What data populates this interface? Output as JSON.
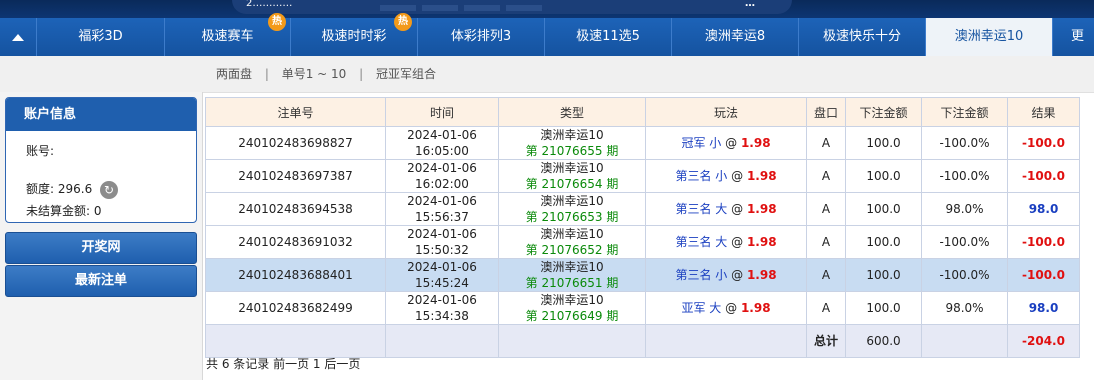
{
  "top": {
    "left_text": "2…………",
    "right_text": "…"
  },
  "nav": {
    "tabs": [
      {
        "label": "福彩3D",
        "hot": false
      },
      {
        "label": "极速赛车",
        "hot": true
      },
      {
        "label": "极速时时彩",
        "hot": true
      },
      {
        "label": "体彩排列3",
        "hot": false
      },
      {
        "label": "极速11选5",
        "hot": false
      },
      {
        "label": "澳洲幸运8",
        "hot": false
      },
      {
        "label": "极速快乐十分",
        "hot": false
      },
      {
        "label": "澳洲幸运10",
        "hot": false,
        "active": true
      },
      {
        "label": "更多",
        "hot": false
      }
    ],
    "hot_label": "热"
  },
  "subnav": {
    "links": [
      "两面盘",
      "单号1 ~ 10",
      "冠亚军组合"
    ],
    "separator": "|"
  },
  "sidebar": {
    "title": "账户信息",
    "account_label": "账号:",
    "account_value": "",
    "credit_label": "额度:",
    "credit_value": "296.6",
    "unsettled_label": "未结算金额:",
    "unsettled_value": "0",
    "draw_button": "开奖网",
    "latest_button": "最新注单"
  },
  "table": {
    "headers": [
      "注单号",
      "时间",
      "类型",
      "玩法",
      "盘口",
      "下注金额",
      "下注金额",
      "结果"
    ],
    "rows": [
      {
        "id": "240102483698827",
        "date": "2024-01-06",
        "time": "16:05:00",
        "game": "澳洲幸运10",
        "issue": "第 21076655 期",
        "pos": "冠军",
        "pick": "小",
        "at": "@",
        "odds": "1.98",
        "pan": "A",
        "amount": "100.0",
        "pct": "-100.0%",
        "result": "-100.0",
        "result_type": "loss"
      },
      {
        "id": "240102483697387",
        "date": "2024-01-06",
        "time": "16:02:00",
        "game": "澳洲幸运10",
        "issue": "第 21076654 期",
        "pos": "第三名",
        "pick": "小",
        "at": "@",
        "odds": "1.98",
        "pan": "A",
        "amount": "100.0",
        "pct": "-100.0%",
        "result": "-100.0",
        "result_type": "loss"
      },
      {
        "id": "240102483694538",
        "date": "2024-01-06",
        "time": "15:56:37",
        "game": "澳洲幸运10",
        "issue": "第 21076653 期",
        "pos": "第三名",
        "pick": "大",
        "at": "@",
        "odds": "1.98",
        "pan": "A",
        "amount": "100.0",
        "pct": "98.0%",
        "result": "98.0",
        "result_type": "win"
      },
      {
        "id": "240102483691032",
        "date": "2024-01-06",
        "time": "15:50:32",
        "game": "澳洲幸运10",
        "issue": "第 21076652 期",
        "pos": "第三名",
        "pick": "大",
        "at": "@",
        "odds": "1.98",
        "pan": "A",
        "amount": "100.0",
        "pct": "-100.0%",
        "result": "-100.0",
        "result_type": "loss"
      },
      {
        "id": "240102483688401",
        "date": "2024-01-06",
        "time": "15:45:24",
        "game": "澳洲幸运10",
        "issue": "第 21076651 期",
        "pos": "第三名",
        "pick": "小",
        "at": "@",
        "odds": "1.98",
        "pan": "A",
        "amount": "100.0",
        "pct": "-100.0%",
        "result": "-100.0",
        "result_type": "loss",
        "highlight": true
      },
      {
        "id": "240102483682499",
        "date": "2024-01-06",
        "time": "15:34:38",
        "game": "澳洲幸运10",
        "issue": "第 21076649 期",
        "pos": "亚军",
        "pick": "大",
        "at": "@",
        "odds": "1.98",
        "pan": "A",
        "amount": "100.0",
        "pct": "98.0%",
        "result": "98.0",
        "result_type": "win"
      }
    ],
    "total_label": "总计",
    "total_amount": "600.0",
    "total_result": "-204.0"
  },
  "footer": {
    "text": "共 6 条记录  前一页  1  后一页"
  },
  "colors": {
    "nav_bg": "#1d63b8",
    "accent": "#1f5fae",
    "loss": "#e01010",
    "win": "#1a3fc0",
    "issue": "#0a8a0a",
    "highlight_row": "#c8dcf2"
  }
}
